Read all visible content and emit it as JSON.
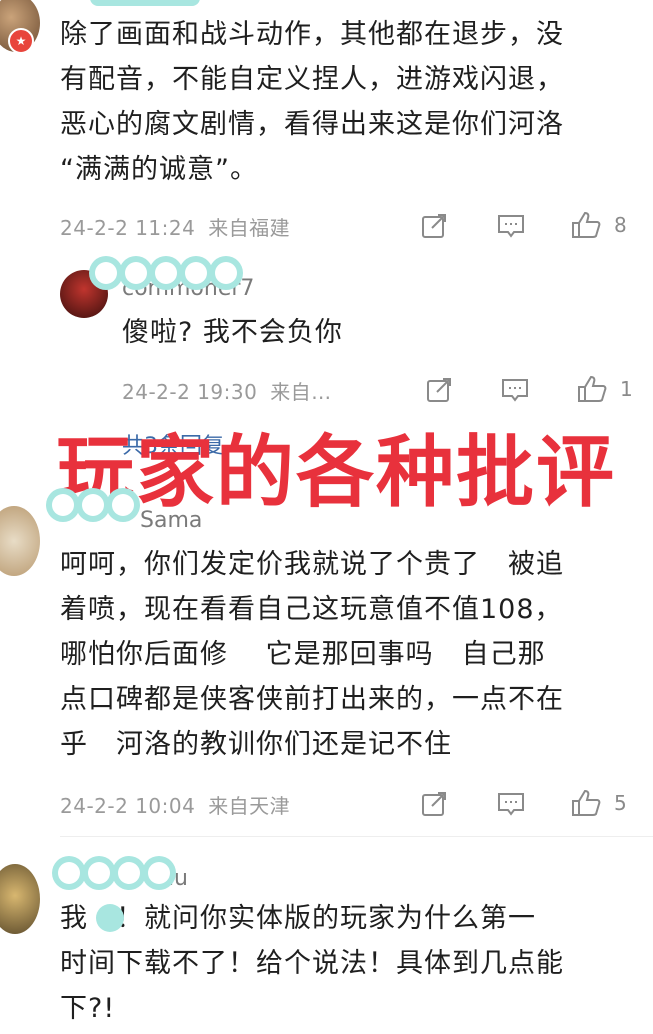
{
  "comments": [
    {
      "id": "c1",
      "username": "",
      "body_lines": [
        "除了画面和战斗动作，其他都在退步，没",
        "有配音，不能自定义捏人，进游戏闪退，",
        "恶心的腐文剧情，看得出来这是你们河洛",
        "“满满的诚意”。"
      ],
      "time": "24-2-2 11:24",
      "location": "来自福建",
      "likes": "8"
    },
    {
      "id": "r1",
      "username": "commoner7",
      "body_lines": [
        "傻啦? 我不会负你"
      ],
      "time": "24-2-2 19:30",
      "location": "来自…",
      "likes": "1"
    },
    {
      "id": "c2",
      "username": "Sama",
      "body_lines": [
        "呵呵，你们发定价我就说了个贵了　被追",
        "着喷，现在看看自己这玩意值不值108，",
        "哪怕你后面修　 它是那回事吗　自己那",
        "点口碑都是侠客侠前打出来的，一点不在",
        "乎　河洛的教训你们还是记不住"
      ],
      "time": "24-2-2 10:04",
      "location": "来自天津",
      "likes": "5"
    },
    {
      "id": "c3",
      "username": "hu",
      "body_lines": [
        "我　！就问你实体版的玩家为什么第一",
        "时间下载不了！给个说法！具体到几点能",
        "下?!"
      ]
    }
  ],
  "replies_link": "共3条回复",
  "overlay_title": "玩家的各种批评",
  "colors": {
    "overlay": "#e8313c",
    "blur": "#a8e6e0",
    "meta": "#9a9a9a"
  }
}
